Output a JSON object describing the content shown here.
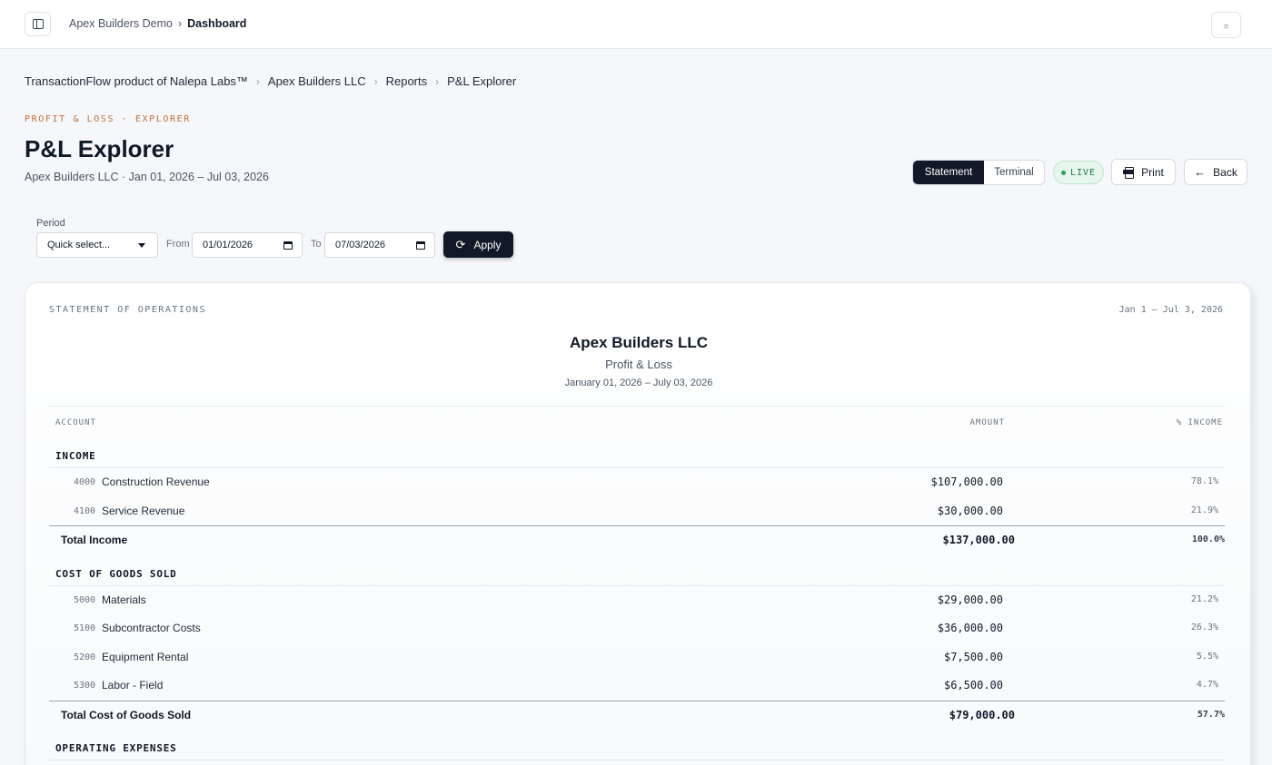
{
  "topbar": {
    "workspace": "Apex Builders Demo",
    "separator": "›",
    "current": "Dashboard",
    "theme_icon": "☼"
  },
  "breadcrumb": [
    "TransactionFlow product of Nalepa Labs™",
    "Apex Builders LLC",
    "Reports",
    "P&L Explorer"
  ],
  "header": {
    "eyebrow": "PROFIT & LOSS · EXPLORER",
    "title": "P&L Explorer",
    "subtitle": "Apex Builders LLC · Jan 01, 2026 – Jul 03, 2026"
  },
  "actions": {
    "view_statement": "Statement",
    "view_terminal": "Terminal",
    "live": "LIVE",
    "print": "Print",
    "back": "Back",
    "back_icon": "←"
  },
  "filter": {
    "period_label": "Period",
    "quick_select": "Quick select...",
    "from_label": "From",
    "from_value": "01/01/2026",
    "to_label": "To",
    "to_value": "07/03/2026",
    "apply": "Apply",
    "apply_icon": "⟳"
  },
  "statement": {
    "tag": "STATEMENT OF OPERATIONS",
    "range_short": "Jan 1 – Jul 3, 2026",
    "company": "Apex Builders LLC",
    "report": "Profit & Loss",
    "range_long": "January 01, 2026 – July 03, 2026",
    "columns": {
      "account": "ACCOUNT",
      "amount": "AMOUNT",
      "pct": "% INCOME"
    },
    "income": {
      "title": "INCOME",
      "rows": [
        {
          "code": "4000",
          "name": "Construction Revenue",
          "amount": "$107,000.00",
          "pct": "78.1%"
        },
        {
          "code": "4100",
          "name": "Service Revenue",
          "amount": "$30,000.00",
          "pct": "21.9%"
        }
      ],
      "total": {
        "name": "Total Income",
        "amount": "$137,000.00",
        "pct": "100.0%"
      }
    },
    "cogs": {
      "title": "COST OF GOODS SOLD",
      "rows": [
        {
          "code": "5000",
          "name": "Materials",
          "amount": "$29,000.00",
          "pct": "21.2%"
        },
        {
          "code": "5100",
          "name": "Subcontractor Costs",
          "amount": "$36,000.00",
          "pct": "26.3%"
        },
        {
          "code": "5200",
          "name": "Equipment Rental",
          "amount": "$7,500.00",
          "pct": "5.5%"
        },
        {
          "code": "5300",
          "name": "Labor - Field",
          "amount": "$6,500.00",
          "pct": "4.7%"
        }
      ],
      "total": {
        "name": "Total Cost of Goods Sold",
        "amount": "$79,000.00",
        "pct": "57.7%"
      }
    },
    "opex": {
      "title": "OPERATING EXPENSES"
    }
  }
}
